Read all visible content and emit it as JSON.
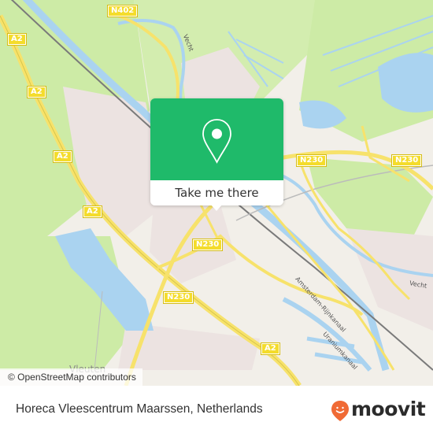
{
  "map": {
    "attribution": "© OpenStreetMap contributors",
    "road_shields": [
      {
        "id": "n402",
        "text": "N402"
      },
      {
        "id": "a2-1",
        "text": "A2"
      },
      {
        "id": "a2-2",
        "text": "A2"
      },
      {
        "id": "a2-3",
        "text": "A2"
      },
      {
        "id": "a2-4",
        "text": "A2"
      },
      {
        "id": "n230-1",
        "text": "N230"
      },
      {
        "id": "n230-2",
        "text": "N230"
      },
      {
        "id": "n230-3",
        "text": "N230"
      },
      {
        "id": "n230-4",
        "text": "N230"
      },
      {
        "id": "a2-5",
        "text": "A2"
      }
    ],
    "labels": {
      "vecht_north": "Vecht",
      "vecht_east": "Vecht",
      "amsterdam_rijnkanaal": "Amsterdam-Rijnkanaal",
      "uraniumkanaal": "Uraniumkanaal",
      "vleuten": "Vleuten"
    },
    "colors": {
      "land": "#f2efe9",
      "grass": "#cdeba6",
      "water": "#aad3f0",
      "urban": "#ece3e1",
      "motorway": "#f7e26b",
      "railway": "#7a7a7a"
    }
  },
  "popup": {
    "icon": "map-pin-icon",
    "action_label": "Take me there",
    "color": "#1fba6a"
  },
  "footer": {
    "place_name": "Horeca Vleescentrum Maarssen, Netherlands",
    "brand": "moovit",
    "brand_color": "#f06a35"
  }
}
